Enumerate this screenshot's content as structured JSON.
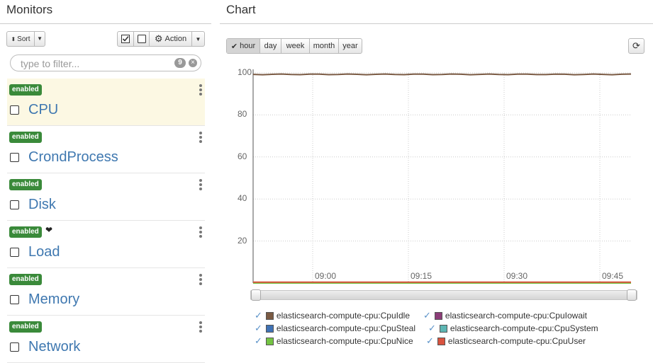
{
  "monitors_panel": {
    "title": "Monitors",
    "sort_label": "Sort",
    "action_label": "Action",
    "filter_placeholder": "type to filter...",
    "filter_count": "9",
    "items": [
      {
        "name": "CPU",
        "status": "enabled",
        "selected": true,
        "favorite": false
      },
      {
        "name": "CrondProcess",
        "status": "enabled",
        "selected": false,
        "favorite": false
      },
      {
        "name": "Disk",
        "status": "enabled",
        "selected": false,
        "favorite": false
      },
      {
        "name": "Load",
        "status": "enabled",
        "selected": false,
        "favorite": true
      },
      {
        "name": "Memory",
        "status": "enabled",
        "selected": false,
        "favorite": false
      },
      {
        "name": "Network",
        "status": "enabled",
        "selected": false,
        "favorite": false
      }
    ]
  },
  "chart_panel": {
    "title": "Chart",
    "range_buttons": [
      "hour",
      "day",
      "week",
      "month",
      "year"
    ],
    "active_range": "hour",
    "refresh_icon": "refresh-icon"
  },
  "chart_data": {
    "type": "line",
    "x_ticks": [
      "09:00",
      "09:15",
      "09:30",
      "09:45"
    ],
    "y_ticks": [
      100,
      80,
      60,
      40,
      20
    ],
    "ylim": [
      0,
      100
    ],
    "grid": true,
    "legend_placement": "bottom",
    "series": [
      {
        "name": "elasticsearch-compute-cpu:CpuIdle",
        "color": "#7a5a43",
        "value": 99.3
      },
      {
        "name": "elasticsearch-compute-cpu:CpuIowait",
        "color": "#8c3d78",
        "value": 0.1
      },
      {
        "name": "elasticsearch-compute-cpu:CpuSteal",
        "color": "#3f72b5",
        "value": 0
      },
      {
        "name": "elasticsearch-compute-cpu:CpuSystem",
        "color": "#5db6b3",
        "value": 0.2
      },
      {
        "name": "elasticsearch-compute-cpu:CpuNice",
        "color": "#74c443",
        "value": 0
      },
      {
        "name": "elasticsearch-compute-cpu:CpuUser",
        "color": "#d9533f",
        "value": 0.4
      }
    ]
  }
}
